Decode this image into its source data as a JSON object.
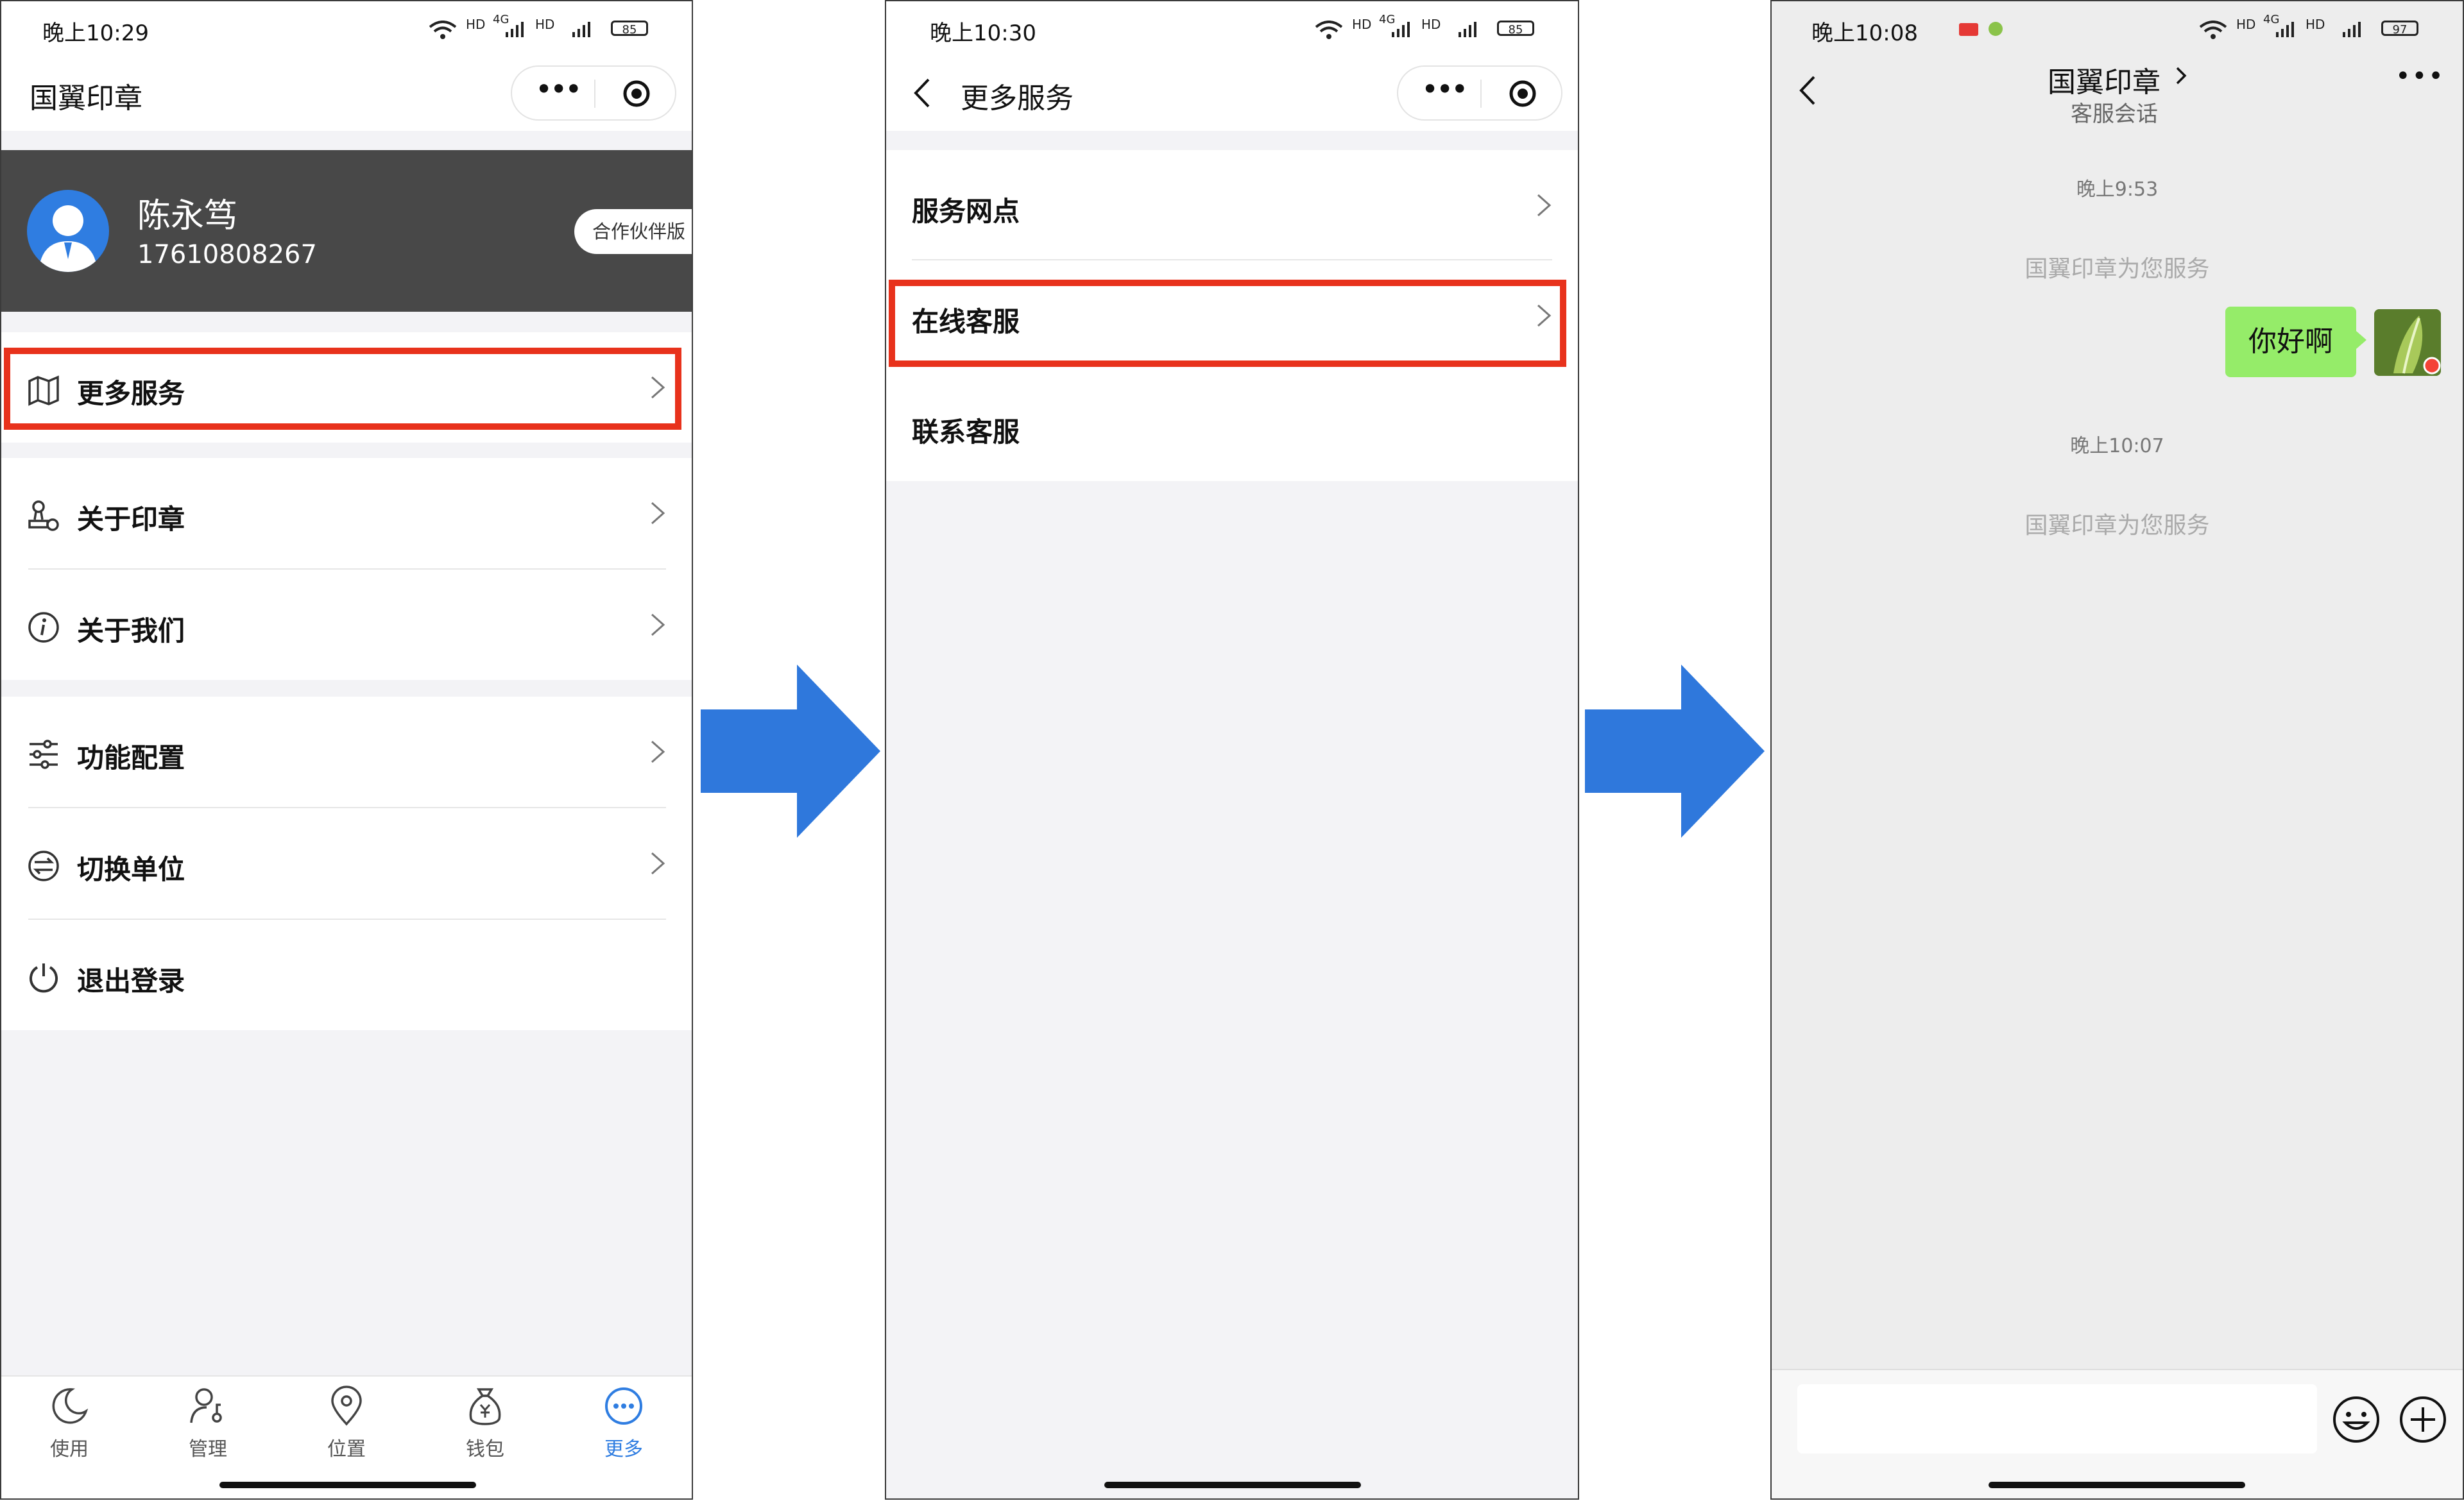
{
  "screen1": {
    "status": {
      "time": "晚上10:29",
      "network": "4G",
      "battery": "85"
    },
    "title": "国翼印章",
    "profile": {
      "name": "陈永笃",
      "phone": "17610808267",
      "badge": "合作伙伴版"
    },
    "menu": [
      {
        "label": "更多服务",
        "icon": "map-icon",
        "highlighted": true
      },
      {
        "label": "关于印章",
        "icon": "stamp-icon"
      },
      {
        "label": "关于我们",
        "icon": "info-icon"
      },
      {
        "label": "功能配置",
        "icon": "sliders-icon"
      },
      {
        "label": "切换单位",
        "icon": "switch-icon"
      },
      {
        "label": "退出登录",
        "icon": "power-icon"
      }
    ],
    "tabs": [
      {
        "label": "使用",
        "icon": "moon-icon"
      },
      {
        "label": "管理",
        "icon": "user-key-icon"
      },
      {
        "label": "位置",
        "icon": "location-icon"
      },
      {
        "label": "钱包",
        "icon": "money-bag-icon"
      },
      {
        "label": "更多",
        "icon": "more-icon",
        "active": true
      }
    ],
    "accent": "#2f7de1"
  },
  "screen2": {
    "status": {
      "time": "晚上10:30",
      "network": "4G",
      "battery": "85"
    },
    "title": "更多服务",
    "items": [
      {
        "label": "服务网点"
      },
      {
        "label": "在线客服",
        "highlighted": true
      },
      {
        "label": "联系客服"
      }
    ]
  },
  "screen3": {
    "status": {
      "time": "晚上10:08",
      "network": "4G",
      "battery": "97"
    },
    "title": "国翼印章",
    "subtitle": "客服会话",
    "messages": [
      {
        "type": "time",
        "text": "晚上9:53"
      },
      {
        "type": "system",
        "text": "国翼印章为您服务"
      },
      {
        "type": "mine",
        "text": "你好啊"
      },
      {
        "type": "time",
        "text": "晚上10:07"
      },
      {
        "type": "system",
        "text": "国翼印章为您服务"
      }
    ],
    "bubble_color": "#95ec69"
  },
  "colors": {
    "highlight": "#e8321c",
    "arrow": "#2f78dc"
  }
}
